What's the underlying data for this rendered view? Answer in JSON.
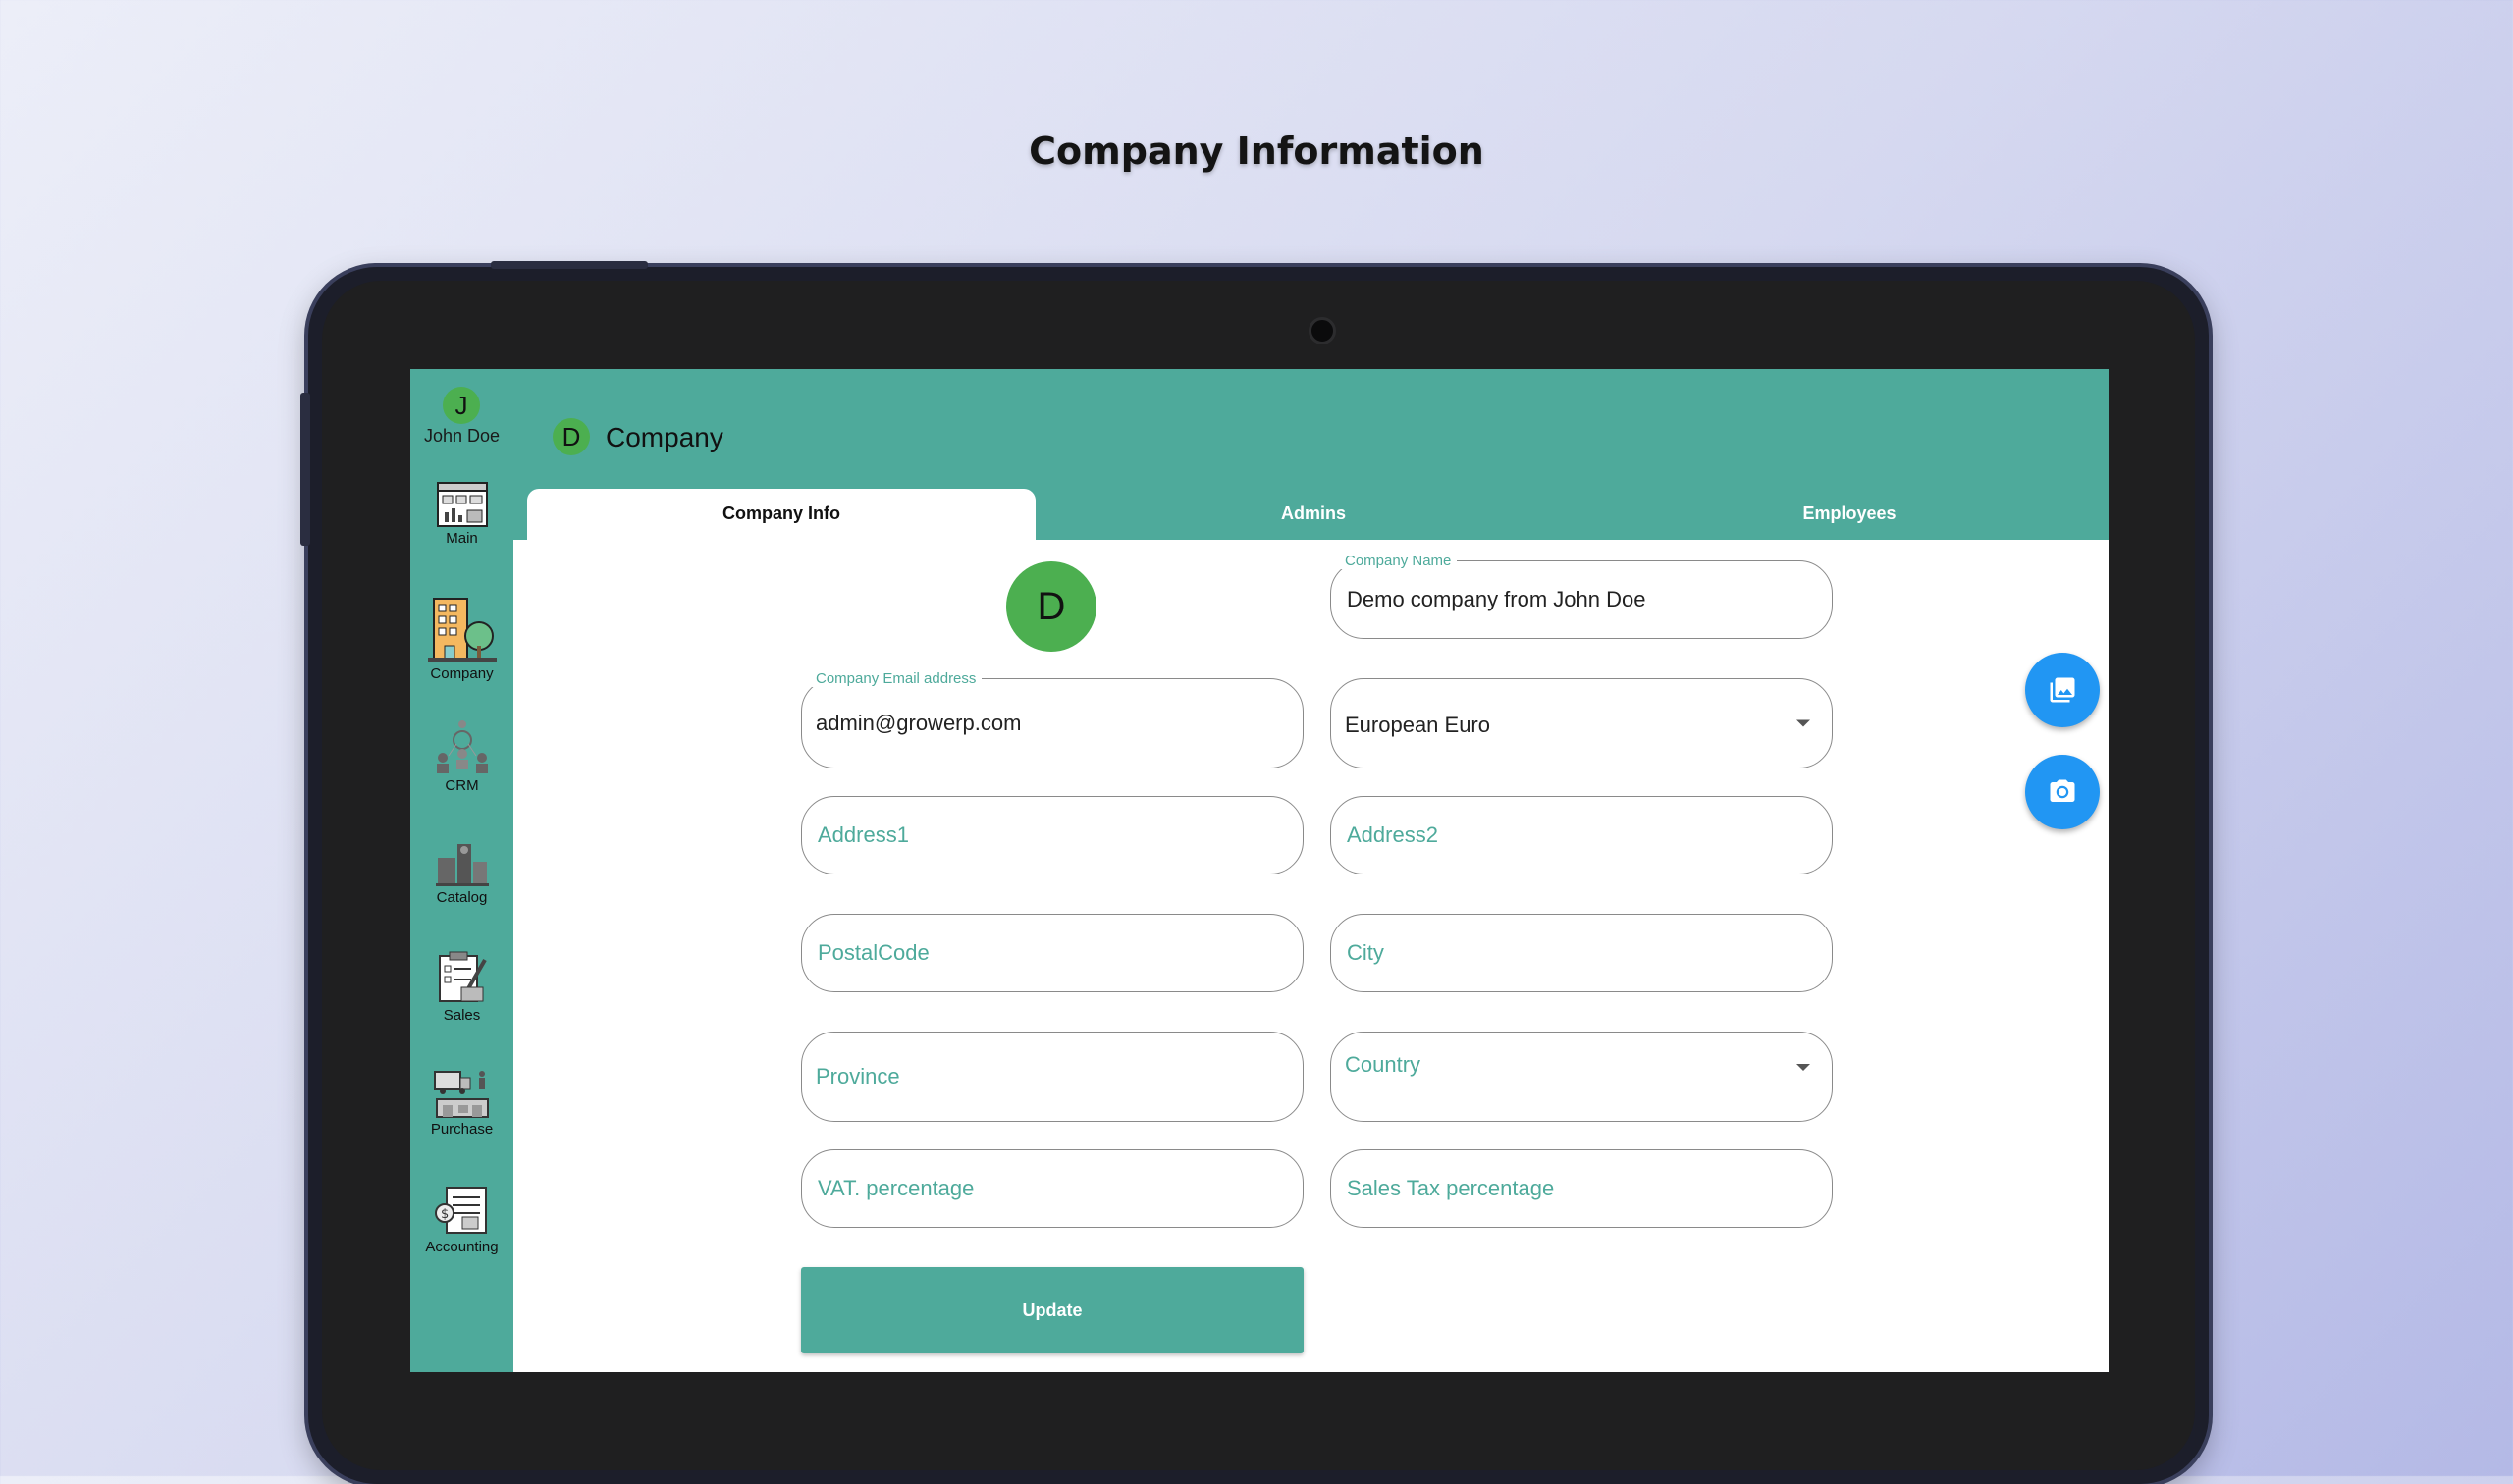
{
  "headline": "Company Information",
  "user": {
    "initial": "J",
    "name": "John Doe"
  },
  "rail": [
    {
      "label": "Main",
      "icon": "dashboard-icon"
    },
    {
      "label": "Company",
      "icon": "building-icon"
    },
    {
      "label": "CRM",
      "icon": "people-network-icon"
    },
    {
      "label": "Catalog",
      "icon": "products-icon"
    },
    {
      "label": "Sales",
      "icon": "sales-clipboard-icon"
    },
    {
      "label": "Purchase",
      "icon": "truck-warehouse-icon"
    },
    {
      "label": "Accounting",
      "icon": "ledger-icon"
    }
  ],
  "appbar": {
    "initial": "D",
    "title": "Company"
  },
  "tabs": {
    "active": "Company Info",
    "admins": "Admins",
    "employees": "Employees"
  },
  "form": {
    "company_initial": "D",
    "company_name_label": "Company Name",
    "company_name": "Demo company from John Doe",
    "email_label": "Company Email address",
    "email": "admin@growerp.com",
    "currency": "European Euro",
    "address1_placeholder": "Address1",
    "address2_placeholder": "Address2",
    "postal_placeholder": "PostalCode",
    "city_placeholder": "City",
    "province_placeholder": "Province",
    "country_placeholder": "Country",
    "vat_placeholder": "VAT. percentage",
    "sales_tax_placeholder": "Sales Tax percentage",
    "update_label": "Update"
  },
  "fabs": [
    {
      "name": "gallery-button",
      "icon": "photo-library-icon"
    },
    {
      "name": "camera-button",
      "icon": "camera-icon"
    }
  ],
  "colors": {
    "primary": "#4eaa9b",
    "avatar": "#4caf50",
    "fab": "#2196f3"
  }
}
